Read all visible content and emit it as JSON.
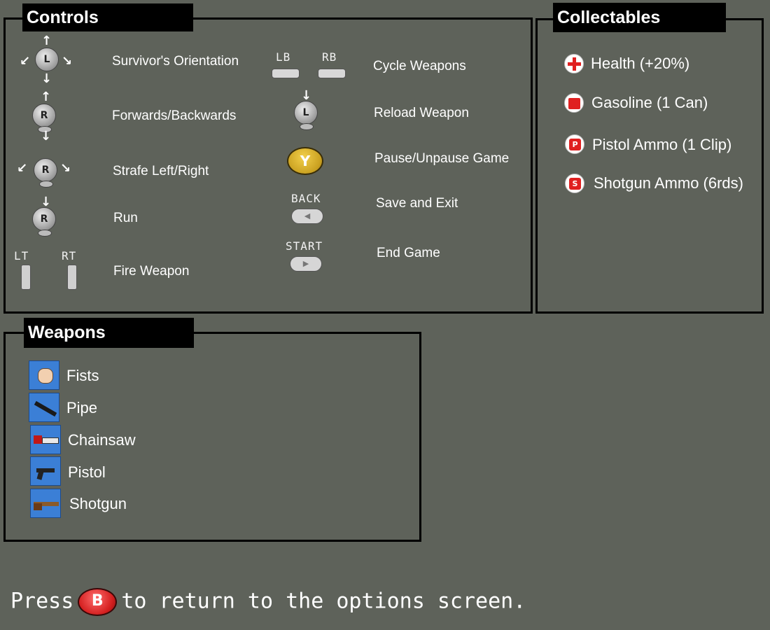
{
  "controls": {
    "title": "Controls",
    "left": [
      {
        "stick": "L",
        "label": "Survivor's Orientation"
      },
      {
        "stick": "R",
        "label": "Forwards/Backwards"
      },
      {
        "stick": "R",
        "label": "Strafe Left/Right"
      },
      {
        "stick": "R",
        "label": "Run"
      },
      {
        "label": "Fire Weapon",
        "buttons": [
          "LT",
          "RT"
        ]
      }
    ],
    "right": [
      {
        "label": "Cycle Weapons",
        "buttons": [
          "LB",
          "RB"
        ]
      },
      {
        "stick": "L",
        "label": "Reload Weapon"
      },
      {
        "button": "Y",
        "label": "Pause/Unpause Game"
      },
      {
        "button": "BACK",
        "label": "Save and Exit"
      },
      {
        "button": "START",
        "label": "End Game"
      }
    ]
  },
  "collectables": {
    "title": "Collectables",
    "items": [
      {
        "icon": "health-cross-icon",
        "label": "Health (+20%)"
      },
      {
        "icon": "gas-can-icon",
        "label": "Gasoline (1 Can)"
      },
      {
        "icon": "pistol-ammo-icon",
        "label": "Pistol Ammo (1 Clip)"
      },
      {
        "icon": "shotgun-ammo-icon",
        "label": "Shotgun Ammo (6rds)"
      }
    ]
  },
  "weapons": {
    "title": "Weapons",
    "items": [
      {
        "icon": "fist-icon",
        "label": "Fists"
      },
      {
        "icon": "pipe-icon",
        "label": "Pipe"
      },
      {
        "icon": "chainsaw-icon",
        "label": "Chainsaw"
      },
      {
        "icon": "pistol-icon",
        "label": "Pistol"
      },
      {
        "icon": "shotgun-icon",
        "label": "Shotgun"
      }
    ]
  },
  "footer": {
    "before": "Press",
    "button": "B",
    "after": "to return to the options screen."
  },
  "colors": {
    "background": "#5e625a",
    "panel_border": "#000000",
    "weapon_icon_bg": "#3b7fd6",
    "collectable_red": "#e02020"
  }
}
